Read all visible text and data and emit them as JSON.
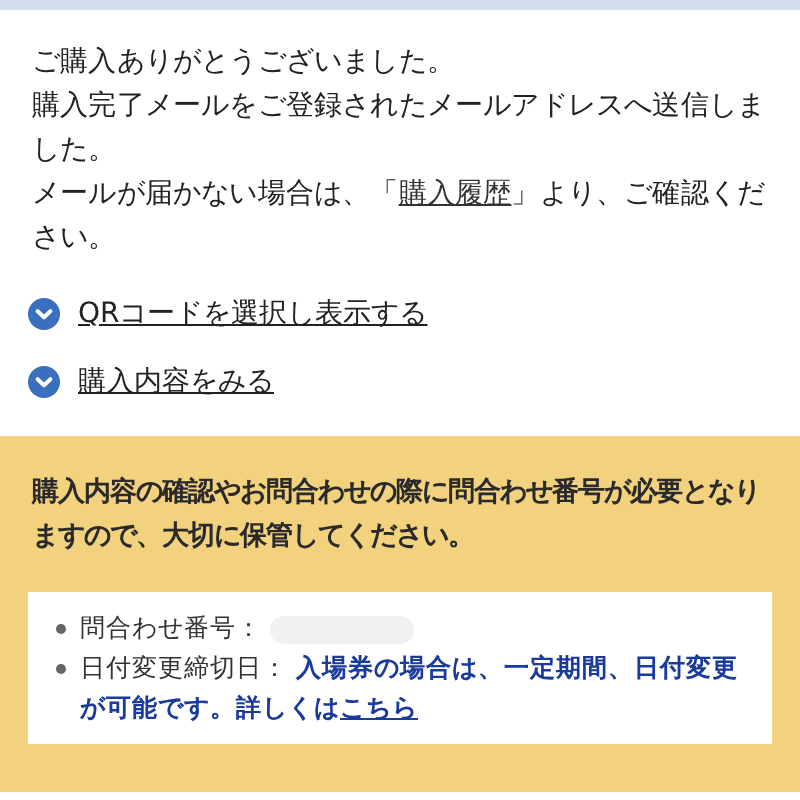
{
  "message": {
    "lines": [
      "ご購入ありがとうございました。",
      "購入完了メールをご登録されたメールアドレスへ送信しました。"
    ],
    "history_line": {
      "before": "メールが届かない場合は、「",
      "link": "購入履歴",
      "after": "」より、ご確認ください。"
    }
  },
  "toggles": [
    {
      "label": "QRコードを選択し表示する",
      "expanded": false
    },
    {
      "label": "購入内容をみる",
      "expanded": false
    }
  ],
  "notice": {
    "text": "購入内容の確認やお問合わせの際に問合わせ番号が必要となりますので、大切に保管してください。",
    "items": [
      {
        "kind": "redacted",
        "label": "問合わせ番号："
      },
      {
        "kind": "note",
        "label": "日付変更締切日：",
        "note": "入場券の場合は、一定期間、日付変更が可能です。詳しくは",
        "link": "こちら"
      }
    ]
  }
}
